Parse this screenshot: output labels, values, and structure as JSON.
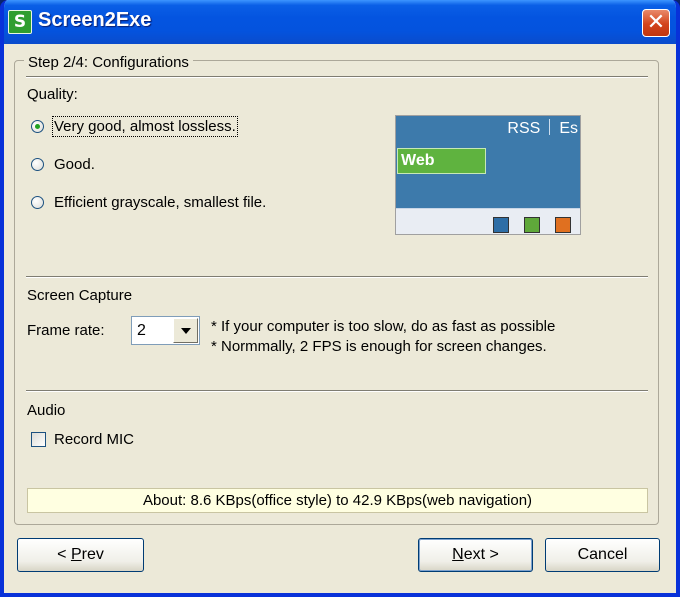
{
  "window": {
    "title": "Screen2Exe",
    "icon": "S",
    "close_glyph": "✕"
  },
  "step": {
    "legend": "Step 2/4: Configurations"
  },
  "quality": {
    "label": "Quality:",
    "options": [
      {
        "label": "Very good, almost lossless.",
        "selected": true
      },
      {
        "label": "Good.",
        "selected": false
      },
      {
        "label": "Efficient grayscale, smallest file.",
        "selected": false
      }
    ],
    "preview": {
      "link_rss": "RSS",
      "link_es": "Es",
      "tab_web": "Web",
      "colors": [
        "#2e6ea6",
        "#5fa83a",
        "#e07020"
      ]
    }
  },
  "capture": {
    "label": "Screen Capture",
    "frame_rate_label": "Frame rate:",
    "frame_rate_value": "2",
    "hint1": "* If your computer is too slow, do as fast as possible",
    "hint2": "* Normmally, 2 FPS is enough for screen changes."
  },
  "audio": {
    "label": "Audio",
    "record_mic_label": "Record MIC",
    "record_mic_checked": false
  },
  "info": "About: 8.6 KBps(office style) to 42.9 KBps(web navigation)",
  "buttons": {
    "prev_prefix": "< ",
    "prev_hotkey": "P",
    "prev_rest": "rev",
    "next_hotkey": "N",
    "next_rest": "ext >",
    "cancel": "Cancel"
  }
}
